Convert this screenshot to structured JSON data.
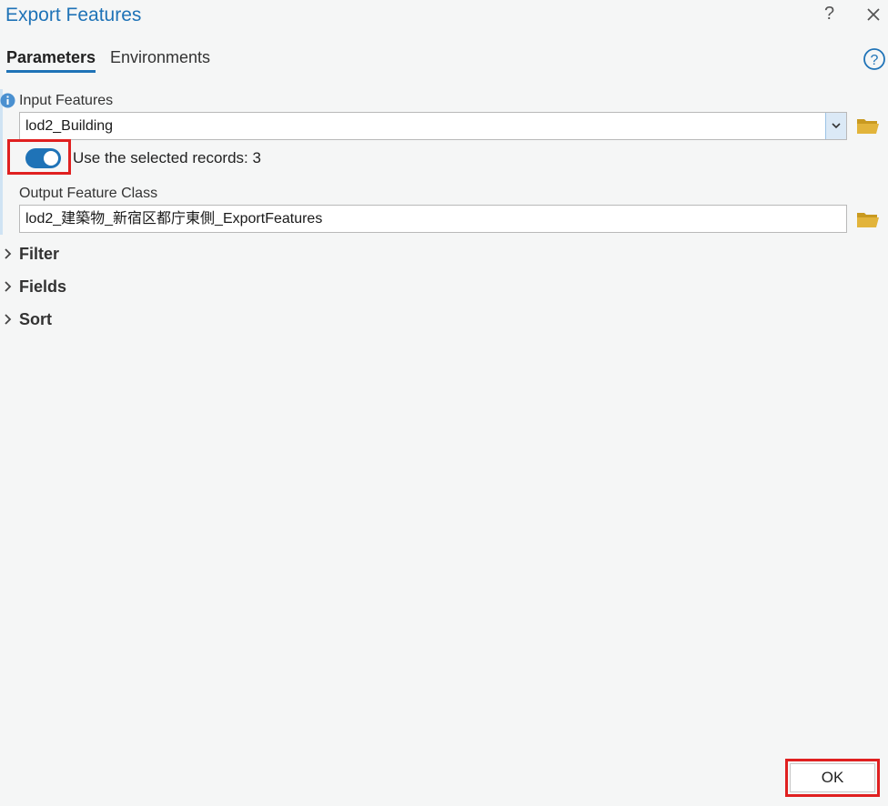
{
  "window": {
    "title": "Export Features",
    "help_glyph": "?",
    "close_icon": "close-icon"
  },
  "tabs": [
    {
      "label": "Parameters",
      "active": true
    },
    {
      "label": "Environments",
      "active": false
    }
  ],
  "params": {
    "input_features": {
      "label": "Input Features",
      "value": "lod2_Building"
    },
    "use_selected": {
      "label": "Use the selected records: 3",
      "checked": true
    },
    "output_feature_class": {
      "label": "Output Feature Class",
      "value": "lod2_建築物_新宿区都庁東側_ExportFeatures"
    }
  },
  "sections": [
    {
      "label": "Filter"
    },
    {
      "label": "Fields"
    },
    {
      "label": "Sort"
    }
  ],
  "footer": {
    "ok_label": "OK"
  },
  "colors": {
    "accent": "#1f73b7",
    "highlight": "#e02020",
    "folder": "#e2b43b"
  }
}
